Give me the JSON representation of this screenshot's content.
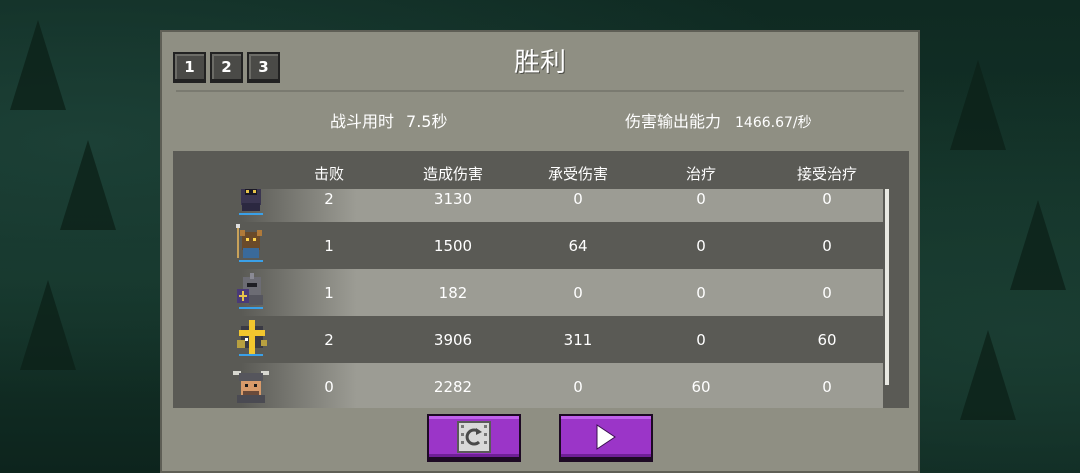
{
  "title": "胜利",
  "tabs": [
    "1",
    "2",
    "3"
  ],
  "stats": {
    "time_label": "战斗用时",
    "time_value": "7.5秒",
    "dps_label": "伤害输出能力",
    "dps_value": "1466.67/秒"
  },
  "table": {
    "headers": [
      "击败",
      "造成伤害",
      "承受伤害",
      "治疗",
      "接受治疗"
    ],
    "rows": [
      {
        "hero_icon": "dark-knight-icon",
        "kills": "2",
        "damage_dealt": "3130",
        "damage_taken": "0",
        "healing": "0",
        "healing_received": "0"
      },
      {
        "hero_icon": "spear-warrior-icon",
        "kills": "1",
        "damage_dealt": "1500",
        "damage_taken": "64",
        "healing": "0",
        "healing_received": "0"
      },
      {
        "hero_icon": "paladin-knight-icon",
        "kills": "1",
        "damage_dealt": "182",
        "damage_taken": "0",
        "healing": "0",
        "healing_received": "0"
      },
      {
        "hero_icon": "holy-cross-knight-icon",
        "kills": "2",
        "damage_dealt": "3906",
        "damage_taken": "311",
        "healing": "0",
        "healing_received": "60"
      },
      {
        "hero_icon": "horned-viking-icon",
        "kills": "0",
        "damage_dealt": "2282",
        "damage_taken": "0",
        "healing": "60",
        "healing_received": "0"
      }
    ]
  },
  "buttons": {
    "replay_icon": "replay-icon",
    "next_icon": "play-arrow-icon"
  },
  "colors": {
    "panel": "#8f8f83",
    "table_bg": "#5a5a55",
    "button_purple": "#9b35c8"
  }
}
